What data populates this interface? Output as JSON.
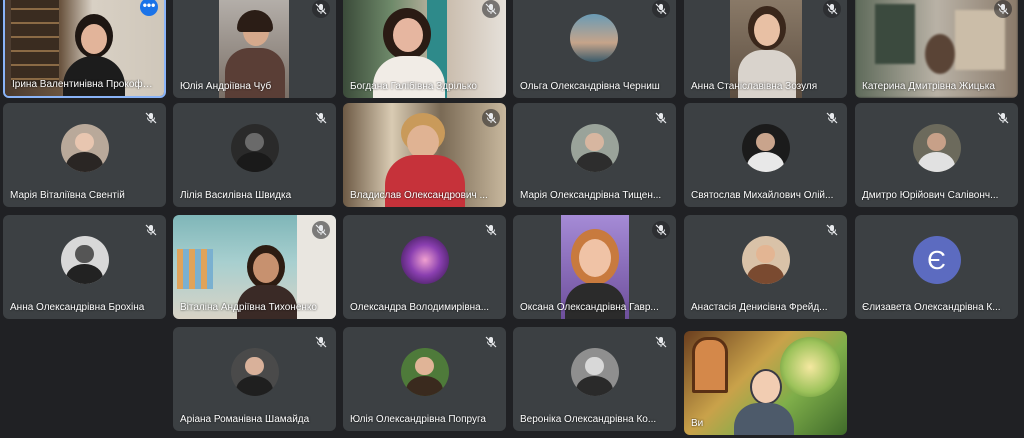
{
  "participants": [
    {
      "name": "Ірина Валентинівна Прокофьєва",
      "muted": false,
      "video": true,
      "active": true
    },
    {
      "name": "Юлія Андріївна Чуб",
      "muted": true,
      "video": true
    },
    {
      "name": "Богдана Галібівна Здрілько",
      "muted": true,
      "video": true
    },
    {
      "name": "Ольга Олександрівна Черниш",
      "muted": true,
      "video": true
    },
    {
      "name": "Анна Станіславівна Зозуля",
      "muted": true,
      "video": true
    },
    {
      "name": "Катерина Дмитрівна Жицька",
      "muted": true,
      "video": true
    },
    {
      "name": "Марія Віталіївна Свентій",
      "muted": true,
      "video": false
    },
    {
      "name": "Лілія Василівна Швидка",
      "muted": true,
      "video": false
    },
    {
      "name": "Владислав Олександрович ...",
      "muted": true,
      "video": true
    },
    {
      "name": "Марія Олександрівна Тищен...",
      "muted": true,
      "video": false
    },
    {
      "name": "Святослав Михайлович Олій...",
      "muted": true,
      "video": false
    },
    {
      "name": "Дмитро Юрійович Салівонч...",
      "muted": true,
      "video": false
    },
    {
      "name": "Анна Олександрівна Брохіна",
      "muted": true,
      "video": false
    },
    {
      "name": "Віталіна Андріївна Тихоненко",
      "muted": true,
      "video": true
    },
    {
      "name": "Олександра Володимирівна...",
      "muted": true,
      "video": false
    },
    {
      "name": "Оксана Олександрівна Гавр...",
      "muted": true,
      "video": true
    },
    {
      "name": "Анастасія Денисівна Фрейд...",
      "muted": true,
      "video": false
    },
    {
      "name": "Єлизавета Олександрівна К...",
      "muted": true,
      "video": false,
      "initial": "Є"
    },
    {
      "name": "Аріана Романівна Шамайда",
      "muted": true,
      "video": false
    },
    {
      "name": "Юлія Олександрівна Попруга",
      "muted": true,
      "video": false
    },
    {
      "name": "Вероніка Олександрівна Ко...",
      "muted": true,
      "video": false
    },
    {
      "name": "Ви",
      "muted": false,
      "video": true
    }
  ],
  "more_button": "•••",
  "colors": {
    "background": "#202124",
    "tile": "#3c4043",
    "active_border": "#8ab4f8",
    "letter_avatar": "#5c6bc0",
    "more_button": "#1a73e8"
  }
}
